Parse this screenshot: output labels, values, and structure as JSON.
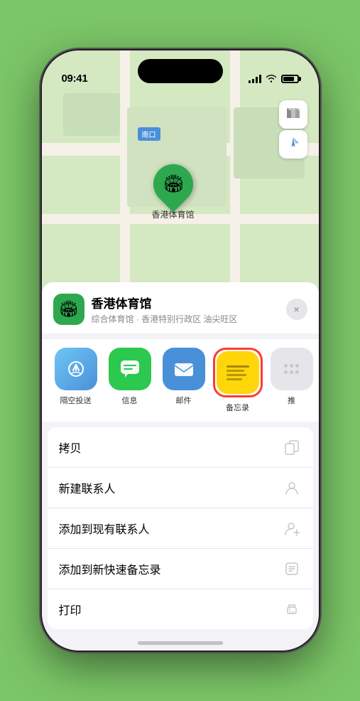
{
  "status": {
    "time": "09:41",
    "location_arrow": "▶"
  },
  "map": {
    "label": "南口",
    "pin_name": "香港体育馆",
    "pin_emoji": "🏟"
  },
  "place_card": {
    "name": "香港体育馆",
    "subtitle": "综合体育馆 · 香港特别行政区 油尖旺区",
    "close_label": "×"
  },
  "share_items": [
    {
      "id": "airdrop",
      "label": "隔空投送",
      "type": "airdrop"
    },
    {
      "id": "message",
      "label": "信息",
      "type": "message"
    },
    {
      "id": "mail",
      "label": "邮件",
      "type": "mail"
    },
    {
      "id": "notes",
      "label": "备忘录",
      "type": "notes",
      "selected": true
    },
    {
      "id": "more",
      "label": "推",
      "type": "more"
    }
  ],
  "actions": [
    {
      "id": "copy",
      "label": "拷贝",
      "icon": "copy"
    },
    {
      "id": "new-contact",
      "label": "新建联系人",
      "icon": "new-contact"
    },
    {
      "id": "add-contact",
      "label": "添加到现有联系人",
      "icon": "add-contact"
    },
    {
      "id": "quick-note",
      "label": "添加到新快速备忘录",
      "icon": "quick-note"
    },
    {
      "id": "print",
      "label": "打印",
      "icon": "print"
    }
  ],
  "map_controls": {
    "map_icon": "🗺",
    "location_icon": "⌖"
  }
}
